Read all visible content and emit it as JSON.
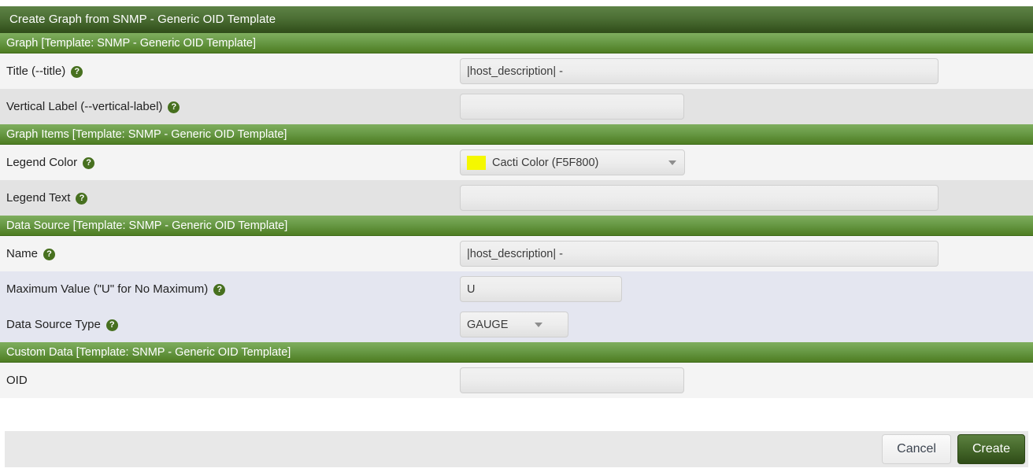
{
  "dialog": {
    "title": "Create Graph from SNMP - Generic OID Template"
  },
  "icons": {
    "help": "?",
    "help_name": "help-icon",
    "caret": "chevron-down-icon"
  },
  "sections": {
    "graph": {
      "header": "Graph [Template: SNMP - Generic OID Template]",
      "fields": {
        "title": {
          "label": "Title (--title)",
          "value": "|host_description| -",
          "placeholder": ""
        },
        "vertical_label": {
          "label": "Vertical Label (--vertical-label)",
          "value": "",
          "placeholder": ""
        }
      }
    },
    "graph_items": {
      "header": "Graph Items [Template: SNMP - Generic OID Template]",
      "fields": {
        "legend_color": {
          "label": "Legend Color",
          "value": "Cacti Color (F5F800)",
          "swatch_hex": "#F5F800"
        },
        "legend_text": {
          "label": "Legend Text",
          "value": "",
          "placeholder": ""
        }
      }
    },
    "data_source": {
      "header": "Data Source [Template: SNMP - Generic OID Template]",
      "fields": {
        "name": {
          "label": "Name",
          "value": "|host_description| -",
          "placeholder": ""
        },
        "maximum_value": {
          "label": "Maximum Value (\"U\" for No Maximum)",
          "value": "U",
          "placeholder": ""
        },
        "data_source_type": {
          "label": "Data Source Type",
          "value": "GAUGE"
        }
      }
    },
    "custom_data": {
      "header": "Custom Data [Template: SNMP - Generic OID Template]",
      "fields": {
        "oid": {
          "label": "OID",
          "value": "",
          "placeholder": ""
        }
      }
    }
  },
  "buttons": {
    "cancel": "Cancel",
    "create": "Create"
  },
  "colors": {
    "header_green": "#4e7d22",
    "titlebar_green": "#2f4c19",
    "create_button_green": "#476a2c",
    "legend_swatch": "#F5F800"
  }
}
